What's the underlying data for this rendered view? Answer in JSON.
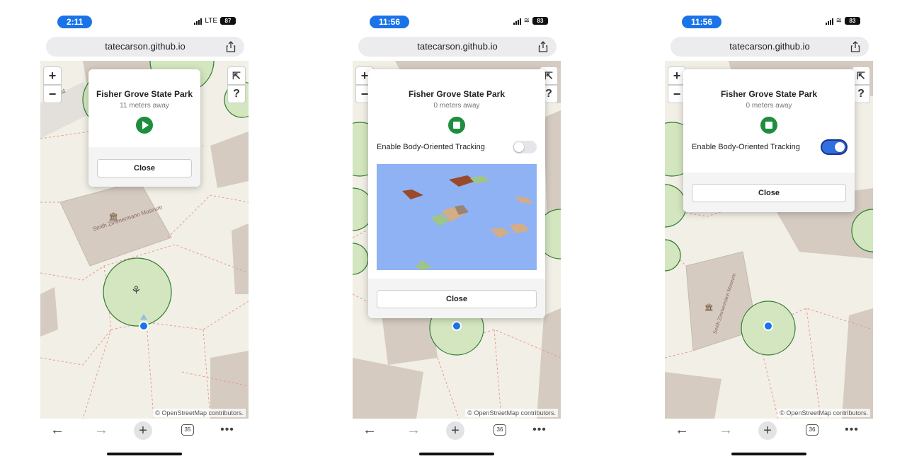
{
  "screens": [
    {
      "status_time": "2:11",
      "network": "LTE",
      "battery": "87",
      "url": "tatecarson.github.io",
      "map_labels": {
        "museum": "Smith Zimmermann Museum",
        "street": "st"
      },
      "popup": {
        "title": "Fisher Grove State Park",
        "distance": "11 meters away",
        "media_state": "play",
        "close_label": "Close"
      },
      "attribution": "© OpenStreetMap contributors.",
      "tab_count": "35"
    },
    {
      "status_time": "11:56",
      "network": "wifi",
      "battery": "83",
      "url": "tatecarson.github.io",
      "popup": {
        "title": "Fisher Grove State Park",
        "distance": "0 meters away",
        "media_state": "stop",
        "tracking_label": "Enable Body-Oriented Tracking",
        "tracking_enabled": false,
        "close_label": "Close"
      },
      "attribution": "© OpenStreetMap contributors.",
      "tab_count": "36"
    },
    {
      "status_time": "11:56",
      "network": "wifi",
      "battery": "83",
      "url": "tatecarson.github.io",
      "map_labels": {
        "museum": "Smith Zimmermann Museum"
      },
      "popup": {
        "title": "Fisher Grove State Park",
        "distance": "0 meters away",
        "media_state": "stop",
        "tracking_label": "Enable Body-Oriented Tracking",
        "tracking_enabled": true,
        "close_label": "Close"
      },
      "attribution": "© OpenStreetMap contributors.",
      "tab_count": "36"
    }
  ],
  "map_controls": {
    "zoom_in": "+",
    "zoom_out": "−",
    "help": "?"
  },
  "nav_icons": {
    "back": "←",
    "forward": "→",
    "new_tab": "+",
    "more": "•••"
  },
  "colors": {
    "accent": "#1a73e8",
    "play_green": "#1e8e3e",
    "toggle_on": "#2f6fe0",
    "map_bg": "#f2efe6",
    "building": "#d5cbc1",
    "park_circle": "#d3e6bf",
    "viz_bg": "#8fb2f5"
  }
}
